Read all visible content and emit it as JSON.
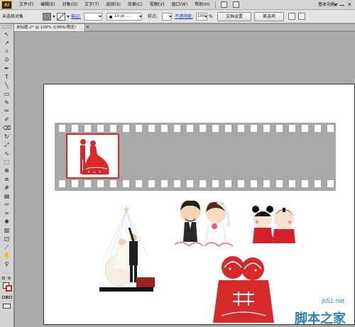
{
  "menubar": {
    "logo": "Ai",
    "items": [
      "文件(F)",
      "编辑(E)",
      "对象(O)",
      "文字(T)",
      "选择(S)",
      "效果(C)",
      "视图(V)",
      "窗口(W)",
      "帮助(H)"
    ],
    "workspace": "基本功能",
    "close_glyph": "✕"
  },
  "controlbar": {
    "selection_label": "未选择对象",
    "stroke_label": "描边:",
    "brush_value": "10 pt. ...",
    "style_label": "样式:",
    "opacity_label": "不透明度:",
    "opacity_value": "100",
    "opacity_unit": "%",
    "doc_settings": "文档设置",
    "preferences": "首选项"
  },
  "tab": {
    "title": "未标题-2* @ 100% (CMYK/预览)",
    "close_glyph": "×"
  },
  "toolbar": {
    "tools": [
      {
        "icon": "selection-tool-icon",
        "glyph": "↖"
      },
      {
        "icon": "direct-selection-tool-icon",
        "glyph": "↗"
      },
      {
        "icon": "magic-wand-icon",
        "glyph": "✧"
      },
      {
        "icon": "lasso-icon",
        "glyph": "ᘐ"
      },
      {
        "icon": "pen-tool-icon",
        "glyph": "✒"
      },
      {
        "icon": "type-tool-icon",
        "glyph": "T"
      },
      {
        "icon": "line-tool-icon",
        "glyph": "╲"
      },
      {
        "icon": "rectangle-tool-icon",
        "glyph": "▭"
      },
      {
        "icon": "paintbrush-icon",
        "glyph": "✎"
      },
      {
        "icon": "pencil-icon",
        "glyph": "✏"
      },
      {
        "icon": "blob-brush-icon",
        "glyph": "✐"
      },
      {
        "icon": "eraser-icon",
        "glyph": "⌫"
      },
      {
        "icon": "rotate-tool-icon",
        "glyph": "↻"
      },
      {
        "icon": "scale-tool-icon",
        "glyph": "⤢"
      },
      {
        "icon": "warp-tool-icon",
        "glyph": "∿"
      },
      {
        "icon": "free-transform-icon",
        "glyph": "⬚"
      },
      {
        "icon": "shape-builder-icon",
        "glyph": "⊕"
      },
      {
        "icon": "perspective-grid-icon",
        "glyph": "⧈"
      },
      {
        "icon": "mesh-tool-icon",
        "glyph": "#"
      },
      {
        "icon": "gradient-tool-icon",
        "glyph": "▤"
      },
      {
        "icon": "eyedropper-icon",
        "glyph": "✑"
      },
      {
        "icon": "blend-tool-icon",
        "glyph": "∞"
      },
      {
        "icon": "symbol-sprayer-icon",
        "glyph": "✺"
      },
      {
        "icon": "column-graph-icon",
        "glyph": "▥"
      },
      {
        "icon": "artboard-tool-icon",
        "glyph": "◳"
      },
      {
        "icon": "slice-tool-icon",
        "glyph": "⟋"
      },
      {
        "icon": "hand-tool-icon",
        "glyph": "✋"
      },
      {
        "icon": "zoom-tool-icon",
        "glyph": "⚲"
      }
    ]
  },
  "canvas": {
    "zoom": "100%",
    "color_mode": "CMYK"
  },
  "colors": {
    "film_strip": "#a7a8aa",
    "frame_border": "#d42a2a",
    "accent_red": "#d2262b"
  },
  "watermark": {
    "url": "jb51.net",
    "brand": "脚本之家"
  }
}
